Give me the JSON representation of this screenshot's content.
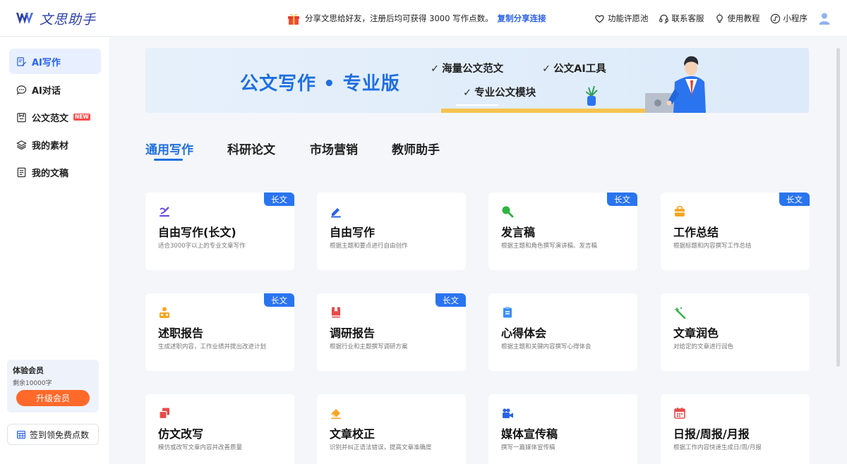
{
  "header": {
    "logo_text": "文思助手",
    "promo_text": "分享文思给好友，注册后均可获得 3000 写作点数。",
    "promo_link": "复制分享连接",
    "nav": [
      {
        "label": "功能许愿池",
        "icon": "heart-icon"
      },
      {
        "label": "联系客服",
        "icon": "headset-icon"
      },
      {
        "label": "使用教程",
        "icon": "lightbulb-icon"
      },
      {
        "label": "小程序",
        "icon": "miniprogram-icon"
      }
    ],
    "avatar_icon": "user-avatar-icon"
  },
  "sidebar": {
    "items": [
      {
        "label": "AI写作",
        "icon": "write-icon",
        "active": true
      },
      {
        "label": "AI对话",
        "icon": "chat-icon",
        "active": false
      },
      {
        "label": "公文范文",
        "icon": "document-template-icon",
        "badge": "NEW",
        "active": false
      },
      {
        "label": "我的素材",
        "icon": "layers-icon",
        "active": false
      },
      {
        "label": "我的文稿",
        "icon": "file-icon",
        "active": false
      }
    ],
    "member": {
      "title": "体验会员",
      "remaining": "剩余10000字",
      "upgrade_label": "升级会员"
    },
    "checkin_label": "签到领免费点数"
  },
  "banner": {
    "title": "公文写作 • 专业版",
    "features": [
      "海量公文范文",
      "公文AI工具",
      "专业公文模块"
    ],
    "check_mark": "✓"
  },
  "tabs": [
    {
      "label": "通用写作",
      "active": true
    },
    {
      "label": "科研论文",
      "active": false
    },
    {
      "label": "市场营销",
      "active": false
    },
    {
      "label": "教师助手",
      "active": false
    }
  ],
  "cards": [
    {
      "title": "自由写作(长文)",
      "desc": "适合3000字以上的专业文章写作",
      "badge": "长文",
      "icon": "pen-signature-icon",
      "color": "#6b4ee6"
    },
    {
      "title": "自由写作",
      "desc": "根据主题和要点进行自由创作",
      "badge": "",
      "icon": "pencil-icon",
      "color": "#2a63e8"
    },
    {
      "title": "发言稿",
      "desc": "根据主题和角色撰写演讲稿、发言稿",
      "badge": "长文",
      "icon": "magnifier-icon",
      "color": "#2fb344"
    },
    {
      "title": "工作总结",
      "desc": "根据标题和内容撰写工作总结",
      "badge": "长文",
      "icon": "briefcase-icon",
      "color": "#f5a623"
    },
    {
      "title": "述职报告",
      "desc": "生成述职内容，工作业绩并提出改进计划",
      "badge": "长文",
      "icon": "people-icon",
      "color": "#f5a623"
    },
    {
      "title": "调研报告",
      "desc": "根据行业和主题撰写调研方案",
      "badge": "长文",
      "icon": "bookmark-book-icon",
      "color": "#e84a4a"
    },
    {
      "title": "心得体会",
      "desc": "根据主题和关键内容撰写心得体会",
      "badge": "",
      "icon": "clipboard-icon",
      "color": "#3a8ef6"
    },
    {
      "title": "文章润色",
      "desc": "对给定的文章进行润色",
      "badge": "",
      "icon": "magic-wand-icon",
      "color": "#2fb344"
    },
    {
      "title": "仿文改写",
      "desc": "模仿或改写文章内容并改善质量",
      "badge": "",
      "icon": "copy-icon",
      "color": "#e84a4a"
    },
    {
      "title": "文章校正",
      "desc": "识别并纠正语法错误，提高文章准确度",
      "badge": "",
      "icon": "eraser-icon",
      "color": "#f5a623"
    },
    {
      "title": "媒体宣传稿",
      "desc": "撰写一篇媒体宣传稿",
      "badge": "",
      "icon": "video-camera-icon",
      "color": "#2a63e8"
    },
    {
      "title": "日报/周报/月报",
      "desc": "根据工作内容快速生成日/周/月报",
      "badge": "",
      "icon": "calendar-icon",
      "color": "#e84a4a"
    }
  ]
}
